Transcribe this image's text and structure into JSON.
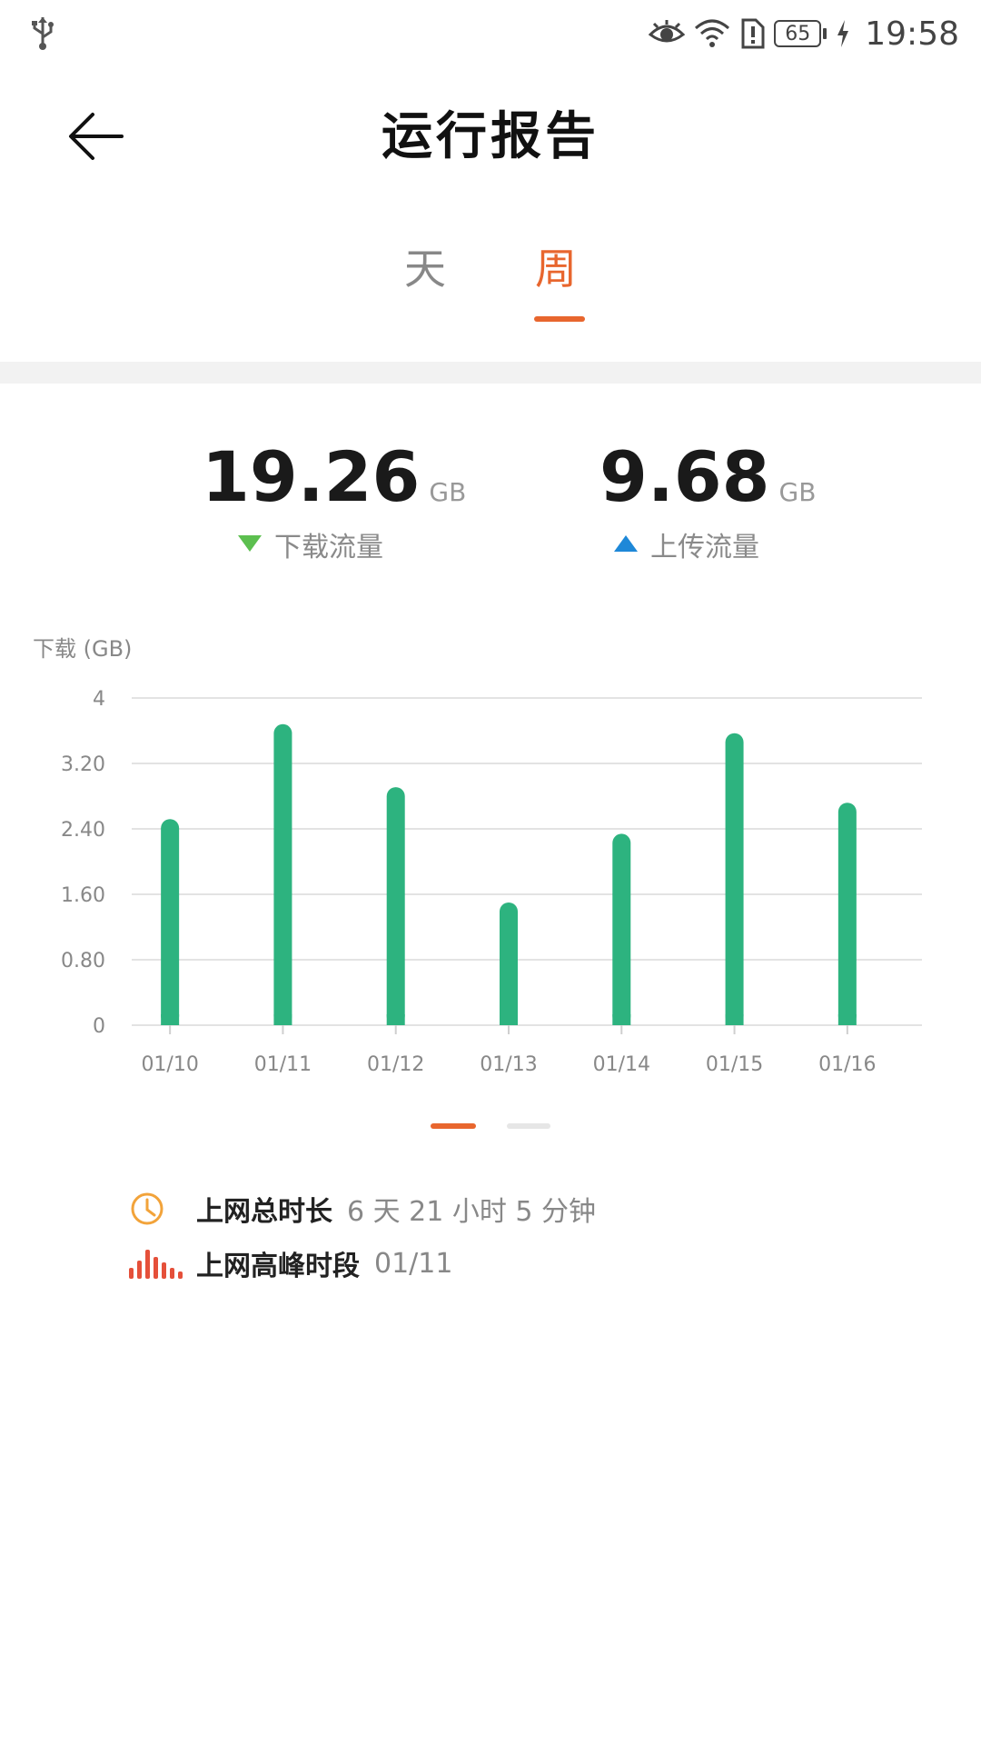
{
  "status_bar": {
    "time": "19:58",
    "battery": "65",
    "icons": [
      "usb-icon",
      "eye-icon",
      "wifi-icon",
      "sim-alert-icon",
      "battery-icon",
      "charging-icon"
    ]
  },
  "header": {
    "title": "运行报告"
  },
  "tabs": [
    {
      "label": "天",
      "active": false
    },
    {
      "label": "周",
      "active": true
    }
  ],
  "summary": {
    "download": {
      "value": "19.26",
      "unit": "GB",
      "label": "下载流量",
      "color": "#5cbf4f"
    },
    "upload": {
      "value": "9.68",
      "unit": "GB",
      "label": "上传流量",
      "color": "#1e88d8"
    }
  },
  "chart_data": {
    "type": "bar",
    "title": "",
    "ylabel": "下载 (GB)",
    "xlabel": "",
    "categories": [
      "01/10",
      "01/11",
      "01/12",
      "01/13",
      "01/14",
      "01/15",
      "01/16"
    ],
    "values": [
      2.52,
      3.68,
      2.91,
      1.5,
      2.34,
      3.57,
      2.72
    ],
    "ylim": [
      0,
      4
    ],
    "yticks": [
      "0",
      "0.80",
      "1.60",
      "2.40",
      "3.20",
      "4"
    ],
    "grid": true,
    "bar_color": "#2db37f"
  },
  "pager": {
    "active_color": "#e8662e",
    "inactive_color": "#e6e6e6"
  },
  "info": [
    {
      "key": "上网总时长",
      "value": "6 天 21 小时 5 分钟",
      "icon": "clock-icon"
    },
    {
      "key": "上网高峰时段",
      "value": "01/11",
      "icon": "peak-bars-icon"
    }
  ]
}
